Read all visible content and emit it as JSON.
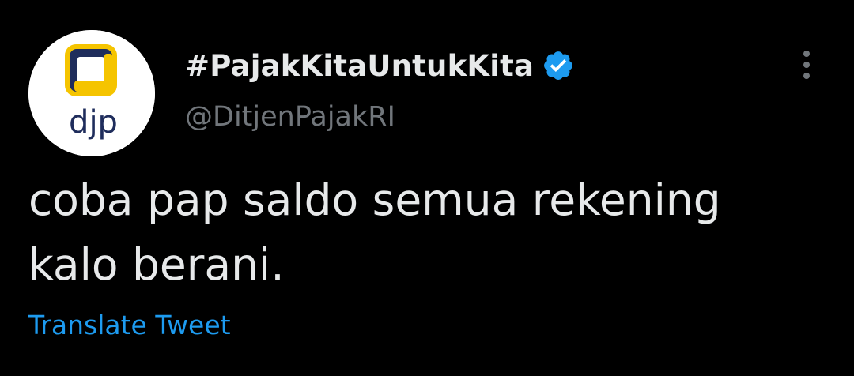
{
  "tweet": {
    "author": {
      "display_name": "#PajakKitaUntukKita",
      "handle": "@DitjenPajakRI",
      "verified": true,
      "avatar": {
        "logo_text": "djp",
        "icon": "djp-logo-icon"
      }
    },
    "text": "coba pap saldo semua rekening\nkalo berani.",
    "translate_label": "Translate Tweet",
    "more_icon": "more-vertical-icon",
    "verified_icon": "verified-badge-icon"
  },
  "colors": {
    "background": "#000000",
    "primary_text": "#e7e9ea",
    "secondary_text": "#71767b",
    "link": "#1d9bf0",
    "verified": "#1d9bf0",
    "logo_yellow": "#f5c400",
    "logo_navy": "#1f2d5c"
  }
}
